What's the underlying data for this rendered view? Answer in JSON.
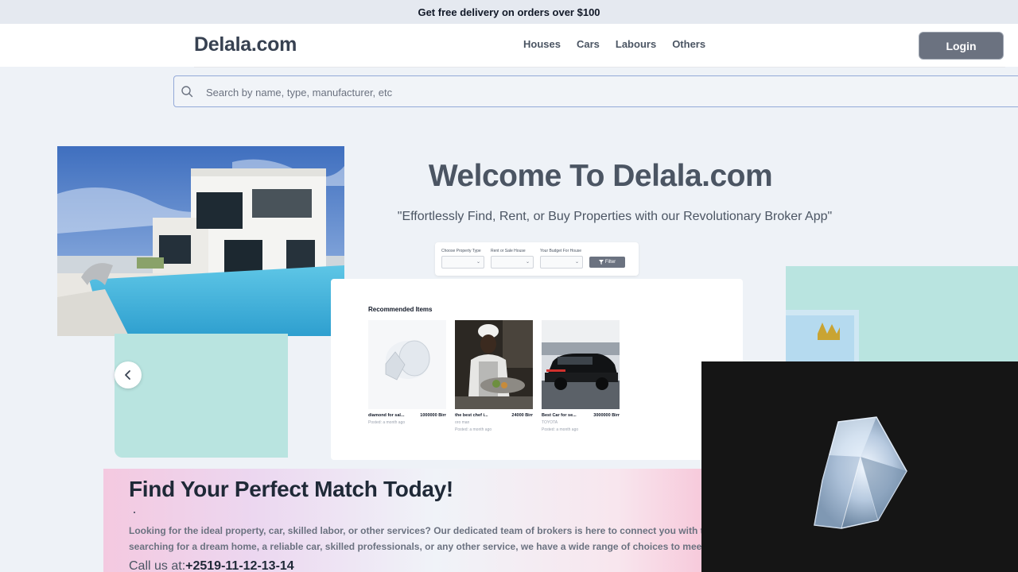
{
  "promo": {
    "text": "Get free delivery on orders over $100"
  },
  "header": {
    "logo": "Delala.com",
    "nav": [
      {
        "label": "Houses"
      },
      {
        "label": "Cars"
      },
      {
        "label": "Labours"
      },
      {
        "label": "Others"
      }
    ],
    "login_label": "Login"
  },
  "search": {
    "placeholder": "Search by name, type, manufacturer, etc",
    "icon": "search-icon"
  },
  "hero": {
    "title": "Welcome To Delala.com",
    "subtitle": "\"Effortlessly Find, Rent, or Buy Properties with our Revolutionary Broker App\""
  },
  "filter": {
    "fields": [
      {
        "label": "Choose Property Type"
      },
      {
        "label": "Rent or Sale House"
      },
      {
        "label": "Your Budget For House"
      }
    ],
    "button_label": "Filter"
  },
  "recommended": {
    "title": "Recommended Items",
    "items": [
      {
        "name": "diamond for sal...",
        "price": "1000000 Birr",
        "seller": "",
        "posted": "Posted: a month ago"
      },
      {
        "name": "the best chef i...",
        "price": "24000 Birr",
        "seller": "oro man",
        "posted": "Posted: a month ago"
      },
      {
        "name": "Best Car for se...",
        "price": "3000000 Birr",
        "seller": "TOYOTA",
        "posted": "Posted: a month ago"
      }
    ]
  },
  "match": {
    "title": "Find Your Perfect Match Today!",
    "line1": "Looking for the ideal property, car, skilled labor, or other services? Our dedicated team of brokers is here to connect you with the best options.",
    "line2": "searching for a dream home, a reliable car, skilled professionals, or any other service, we have a wide range of choices to meet your needs.",
    "call_prefix": "Call us at:",
    "phone": "+2519-11-12-13-14"
  }
}
